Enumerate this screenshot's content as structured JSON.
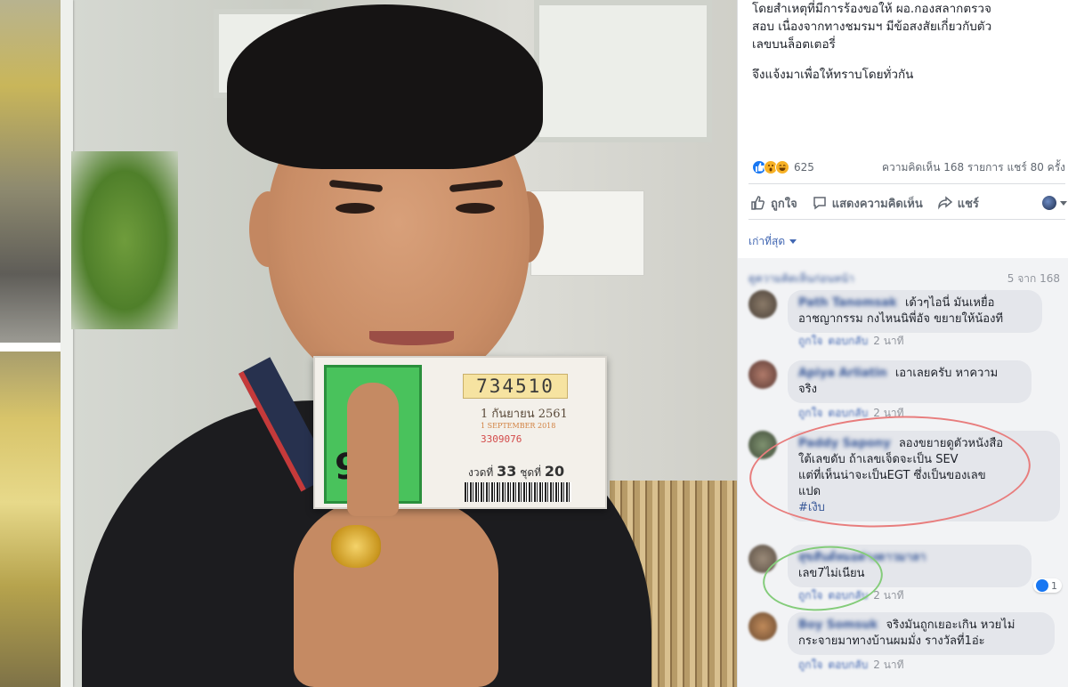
{
  "post": {
    "text_line1": "โดยสำเหตุที่มีการร้องขอให้ ผอ.กองสลากตรวจ",
    "text_line2": "สอบ เนื่องจากทางชมรมฯ มีข้อสงสัยเกี่ยวกับตัว",
    "text_line3": "เลขบนล็อตเตอรี่",
    "text_line4": "จึงแจ้งมาเพื่อให้ทราบโดยทั่วกัน",
    "reaction_count": "625",
    "comment_count_label": "ความคิดเห็น 168 รายการ",
    "share_count_label": "แชร์ 80 ครั้ง"
  },
  "actions": {
    "like": "ถูกใจ",
    "comment": "แสดงความคิดเห็น",
    "share": "แชร์"
  },
  "sort": {
    "label": "เก่าที่สุด"
  },
  "pager": {
    "prev_label": "ดูความคิดเห็นก่อนหน้า",
    "count": "5 จาก 168"
  },
  "comments": [
    {
      "author": "Path Tanomsak",
      "line1": "เด้วๆไอนี่ มันเหยื่อ",
      "line2": "อาชญากรรม กงไหนนิพี่อัจ ขยายให้น้องที",
      "like": "ถูกใจ",
      "reply": "ตอบกลับ",
      "time": "2 นาที"
    },
    {
      "author": "Apiya Arliatin",
      "line1": "เอาเลยครับ หาความ",
      "line2": "จริง",
      "like": "ถูกใจ",
      "reply": "ตอบกลับ",
      "time": "2 นาที"
    },
    {
      "author": "Paddy Sapony",
      "line1": "ลองขยายดูตัวหนังสือ",
      "line2": "ใต้เลขดับ ถ้าเลขเจ็ดจะเป็น SEV",
      "line3": "แต่ที่เห็นน่าจะเป็นEGT ซึ่งเป็นของเลข",
      "line4": "แปด",
      "hashtag": "#เงิบ",
      "like": "ถูกใจ",
      "reply": "ตอบกลับ",
      "time": "2 นาที"
    },
    {
      "author": "สุขสันต์หมอต่างดาวมาลา",
      "line1": "เลข7ไม่เนียน",
      "like": "ถูกใจ",
      "reply": "ตอบกลับ",
      "time": "2 นาที",
      "likes": "1"
    },
    {
      "author": "Boy Somsuk",
      "line1": "จริงมันถูกเยอะเกิน หวยไม่",
      "line2": "กระจายมาทางบ้านผมมั่ง รางวัลที่1อ่ะ",
      "like": "ถูกใจ",
      "reply": "ตอบกลับ",
      "time": "2 นาที"
    }
  ],
  "ticket": {
    "number": "734510",
    "date_th": "1 กันยายน 2561",
    "date_en": "1 SEPTEMBER 2018",
    "red_code": "3309076",
    "set_label_a": "งวดที่",
    "set_value_a": "33",
    "set_label_b": "ชุดที่",
    "set_value_b": "20",
    "big_number": "90"
  },
  "colors": {
    "link": "#385898",
    "bubble": "#e4e6eb",
    "annotation_red": "#e87d7d",
    "annotation_green": "#84cc7a"
  },
  "icons": [
    "like-icon",
    "wow-icon",
    "haha-icon",
    "comment-icon",
    "share-icon",
    "globe-icon"
  ]
}
